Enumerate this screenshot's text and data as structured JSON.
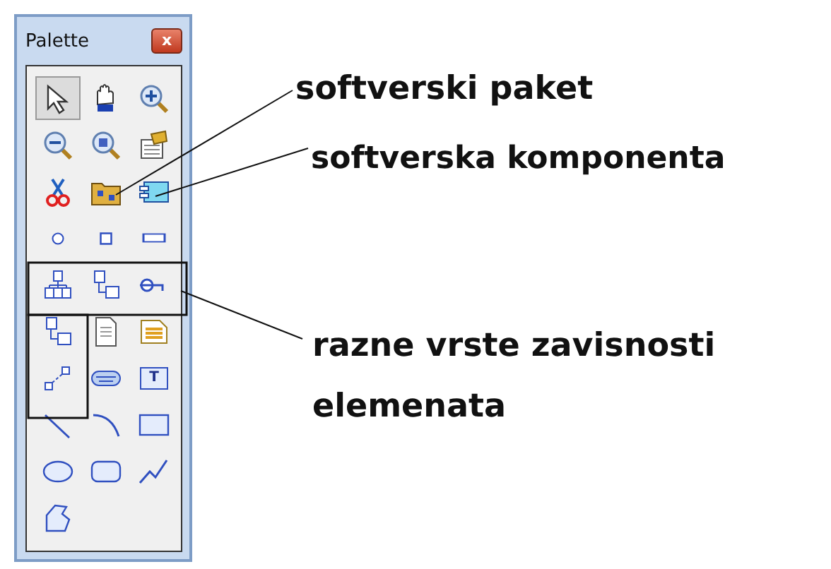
{
  "palette": {
    "title": "Palette",
    "close_glyph": "x",
    "tools": [
      {
        "kind": "pointer",
        "selected": true
      },
      {
        "kind": "hand",
        "selected": false
      },
      {
        "kind": "zoom-in",
        "selected": false
      },
      {
        "kind": "zoom-out",
        "selected": false
      },
      {
        "kind": "zoom-fit",
        "selected": false
      },
      {
        "kind": "properties",
        "selected": false
      },
      {
        "kind": "scissors",
        "selected": false
      },
      {
        "kind": "package",
        "selected": false
      },
      {
        "kind": "component",
        "selected": false
      },
      {
        "kind": "circle",
        "selected": false
      },
      {
        "kind": "square",
        "selected": false
      },
      {
        "kind": "bar",
        "selected": false
      },
      {
        "kind": "hierarchy",
        "selected": false
      },
      {
        "kind": "link",
        "selected": false
      },
      {
        "kind": "interface",
        "selected": false
      },
      {
        "kind": "link",
        "selected": false
      },
      {
        "kind": "document",
        "selected": false
      },
      {
        "kind": "note",
        "selected": false
      },
      {
        "kind": "dependency",
        "selected": false
      },
      {
        "kind": "device",
        "selected": false
      },
      {
        "kind": "text",
        "label": "T",
        "selected": false
      },
      {
        "kind": "line",
        "selected": false
      },
      {
        "kind": "arc",
        "selected": false
      },
      {
        "kind": "rectangle",
        "selected": false
      },
      {
        "kind": "ellipse",
        "selected": false
      },
      {
        "kind": "rounded",
        "selected": false
      },
      {
        "kind": "polyline",
        "selected": false
      },
      {
        "kind": "polygon",
        "selected": false
      }
    ]
  },
  "annotations": [
    {
      "text": "softverski paket"
    },
    {
      "text": "softverska komponenta"
    },
    {
      "text": "razne vrste zavisnosti"
    },
    {
      "text": "elemenata"
    }
  ]
}
